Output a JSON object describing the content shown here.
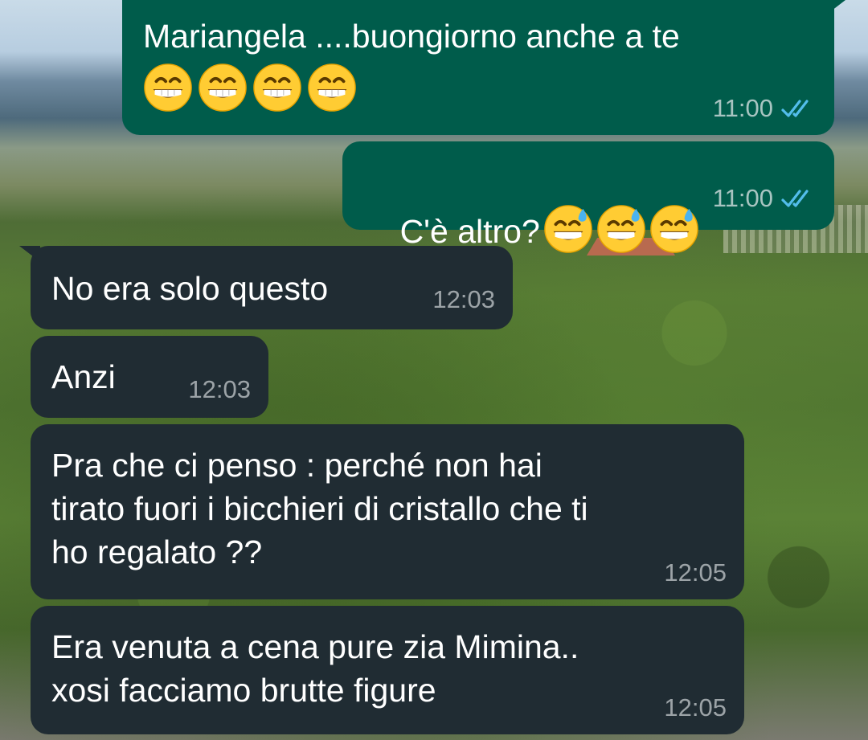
{
  "messages": [
    {
      "direction": "outgoing",
      "text": "Mariangela ....buongiorno anche a te",
      "emoji": [
        "grinning-face-with-smiling-eyes",
        "grinning-face-with-smiling-eyes",
        "grinning-face-with-smiling-eyes",
        "grinning-face-with-smiling-eyes"
      ],
      "time": "11:00",
      "status": "read"
    },
    {
      "direction": "outgoing",
      "text": "C'è altro?",
      "emoji": [
        "grinning-face-with-sweat",
        "grinning-face-with-sweat",
        "grinning-face-with-sweat"
      ],
      "time": "11:00",
      "status": "read"
    },
    {
      "direction": "incoming",
      "text": "No era solo questo",
      "time": "12:03"
    },
    {
      "direction": "incoming",
      "text": "Anzi",
      "time": "12:03"
    },
    {
      "direction": "incoming",
      "text": "Pra che ci penso : perché non hai\ntirato fuori i bicchieri di cristallo che ti\nho regalato ??",
      "time": "12:05"
    },
    {
      "direction": "incoming",
      "text": "Era venuta a cena pure zia Mimina..\nxosi facciamo brutte figure",
      "time": "12:05"
    }
  ],
  "colors": {
    "outgoing_bubble": "#005c4b",
    "incoming_bubble": "#202c33",
    "read_tick": "#53bdeb",
    "text": "#ffffff"
  }
}
